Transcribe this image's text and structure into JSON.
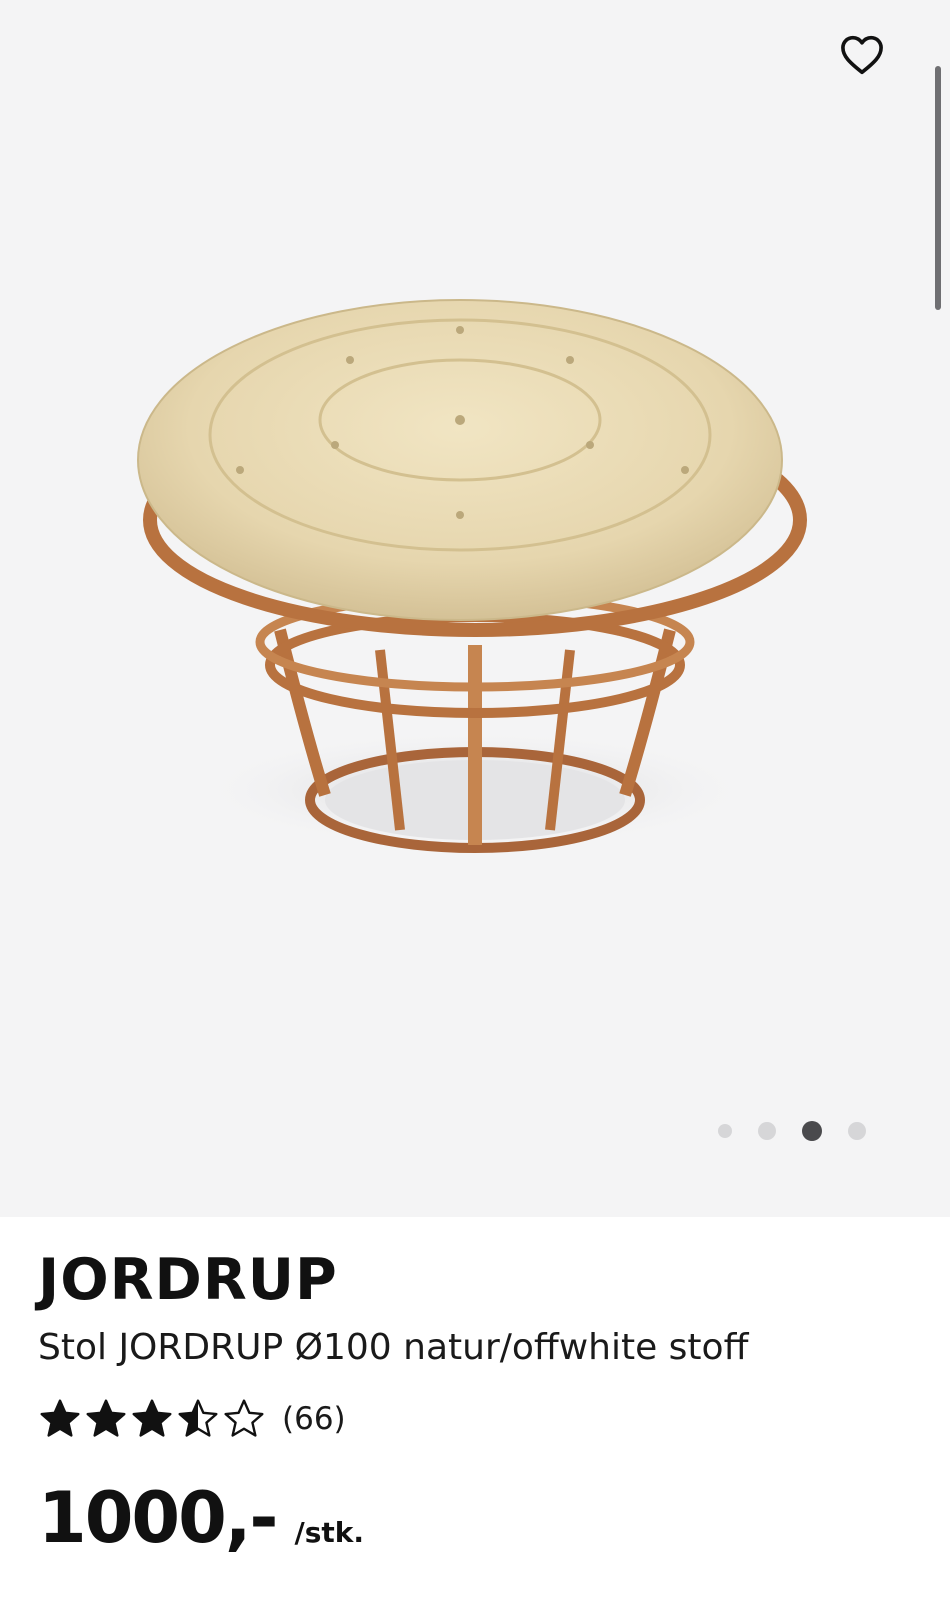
{
  "gallery": {
    "image_alt": "Stol JORDRUP",
    "favorite_icon": "heart-outline-icon",
    "dots": [
      {
        "active": false
      },
      {
        "active": false
      },
      {
        "active": true
      },
      {
        "active": false
      }
    ],
    "current_image": 3,
    "total_images": 4
  },
  "product": {
    "brand": "JORDRUP",
    "subtitle": "Stol JORDRUP Ø100 natur/offwhite stoff",
    "rating": 3.5,
    "rating_max": 5,
    "review_count": "(66)",
    "price": "1000,-",
    "unit": "/stk."
  },
  "colors": {
    "gallery_bg": "#f4f4f5",
    "text": "#111111",
    "dot_active": "#4a4a4d",
    "dot_inactive": "#d6d6d8"
  }
}
